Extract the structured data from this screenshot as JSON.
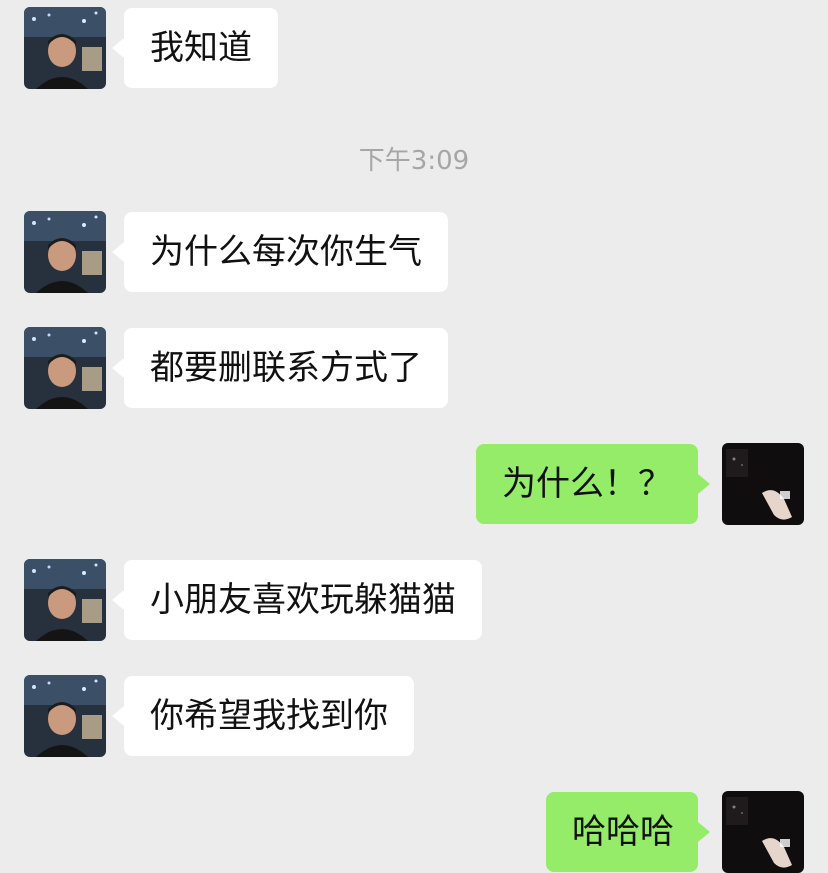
{
  "chat": {
    "messages": [
      {
        "sender": "contact",
        "text": "我知道"
      },
      {
        "timestamp": "下午3:09"
      },
      {
        "sender": "contact",
        "text": "为什么每次你生气"
      },
      {
        "sender": "contact",
        "text": "都要删联系方式了"
      },
      {
        "sender": "self",
        "text": "为什么！？"
      },
      {
        "sender": "contact",
        "text": "小朋友喜欢玩躲猫猫"
      },
      {
        "sender": "contact",
        "text": "你希望我找到你"
      },
      {
        "sender": "self",
        "text": "哈哈哈"
      }
    ]
  },
  "colors": {
    "background": "#ececec",
    "incoming_bubble": "#ffffff",
    "outgoing_bubble": "#95ec69",
    "timestamp_text": "#a6a6a6"
  }
}
